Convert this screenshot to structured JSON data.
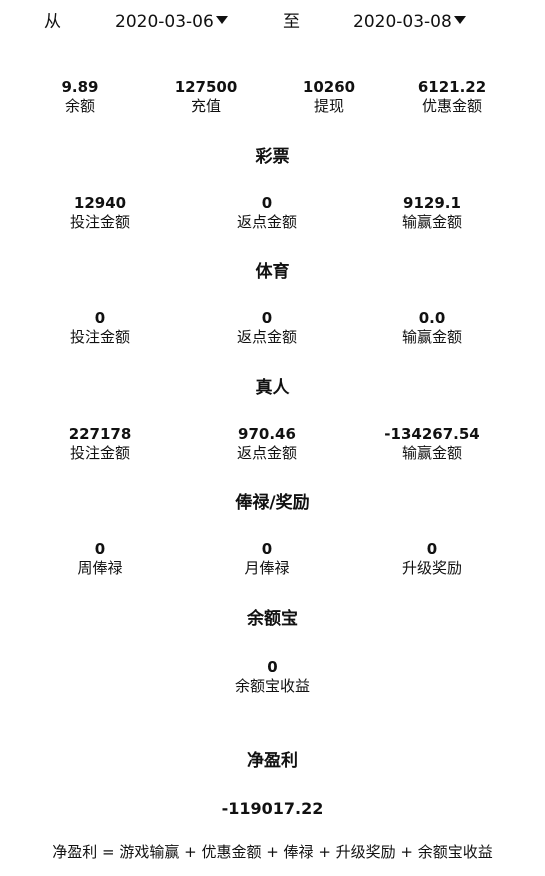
{
  "date_filter": {
    "from_label": "从",
    "from_date": "2020-03-06",
    "to_label": "至",
    "to_date": "2020-03-08"
  },
  "summary": [
    {
      "value": "9.89",
      "label": "余额"
    },
    {
      "value": "127500",
      "label": "充值"
    },
    {
      "value": "10260",
      "label": "提现"
    },
    {
      "value": "6121.22",
      "label": "优惠金额"
    }
  ],
  "lottery": {
    "title": "彩票",
    "items": [
      {
        "value": "12940",
        "label": "投注金额"
      },
      {
        "value": "0",
        "label": "返点金额"
      },
      {
        "value": "9129.1",
        "label": "输赢金额"
      }
    ]
  },
  "sports": {
    "title": "体育",
    "items": [
      {
        "value": "0",
        "label": "投注金额"
      },
      {
        "value": "0",
        "label": "返点金额"
      },
      {
        "value": "0.0",
        "label": "输赢金额"
      }
    ]
  },
  "live": {
    "title": "真人",
    "items": [
      {
        "value": "227178",
        "label": "投注金额"
      },
      {
        "value": "970.46",
        "label": "返点金额"
      },
      {
        "value": "-134267.54",
        "label": "输赢金额"
      }
    ]
  },
  "salary": {
    "title": "俸禄/奖励",
    "items": [
      {
        "value": "0",
        "label": "周俸禄"
      },
      {
        "value": "0",
        "label": "月俸禄"
      },
      {
        "value": "0",
        "label": "升级奖励"
      }
    ]
  },
  "balance_treasure": {
    "title": "余额宝",
    "value": "0",
    "label": "余额宝收益"
  },
  "net_profit": {
    "title": "净盈利",
    "value": "-119017.22",
    "formula": "净盈利 = 游戏输赢 + 优惠金额 + 俸禄 + 升级奖励 + 余额宝收益"
  }
}
